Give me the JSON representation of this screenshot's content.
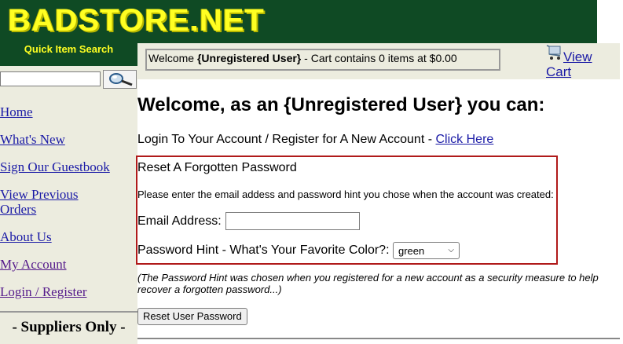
{
  "header": {
    "logo_text": "BADSTORE.NET",
    "quick_search_label": "Quick Item Search"
  },
  "sidebar": {
    "search_placeholder": "",
    "items": [
      {
        "label": "Home"
      },
      {
        "label": "What's New"
      },
      {
        "label": "Sign Our Guestbook"
      },
      {
        "label": "View Previous Orders"
      },
      {
        "label": "About Us"
      },
      {
        "label": "My Account"
      },
      {
        "label": "Login / Register"
      }
    ],
    "suppliers_label": "- Suppliers Only -"
  },
  "topbar": {
    "welcome_prefix": "Welcome ",
    "user": "{Unregistered User}",
    "cart_summary": " - Cart contains 0 items at $0.00",
    "view_cart_label": "View Cart"
  },
  "main": {
    "title": "Welcome, as an {Unregistered User} you can:",
    "login_text": "Login To Your Account / Register for A New Account - ",
    "login_link": "Click Here",
    "reset": {
      "title": "Reset A Forgotten Password",
      "instructions": "Please enter the email addess and password hint you chose when the account was created:",
      "email_label": "Email Address:",
      "email_value": "",
      "hint_label": "Password Hint - What's Your Favorite Color?:",
      "hint_selected": "green"
    },
    "hint_note": "(The Password Hint was chosen when you registered for a new account as a security measure to help recover a forgotten password...)",
    "reset_button": "Reset User Password"
  },
  "colors": {
    "banner_bg": "#0f4a24",
    "logo_yellow": "#ffff22",
    "sidebar_bg": "#ececdf",
    "link": "#1a1aa6",
    "reset_border": "#b01a1a"
  }
}
